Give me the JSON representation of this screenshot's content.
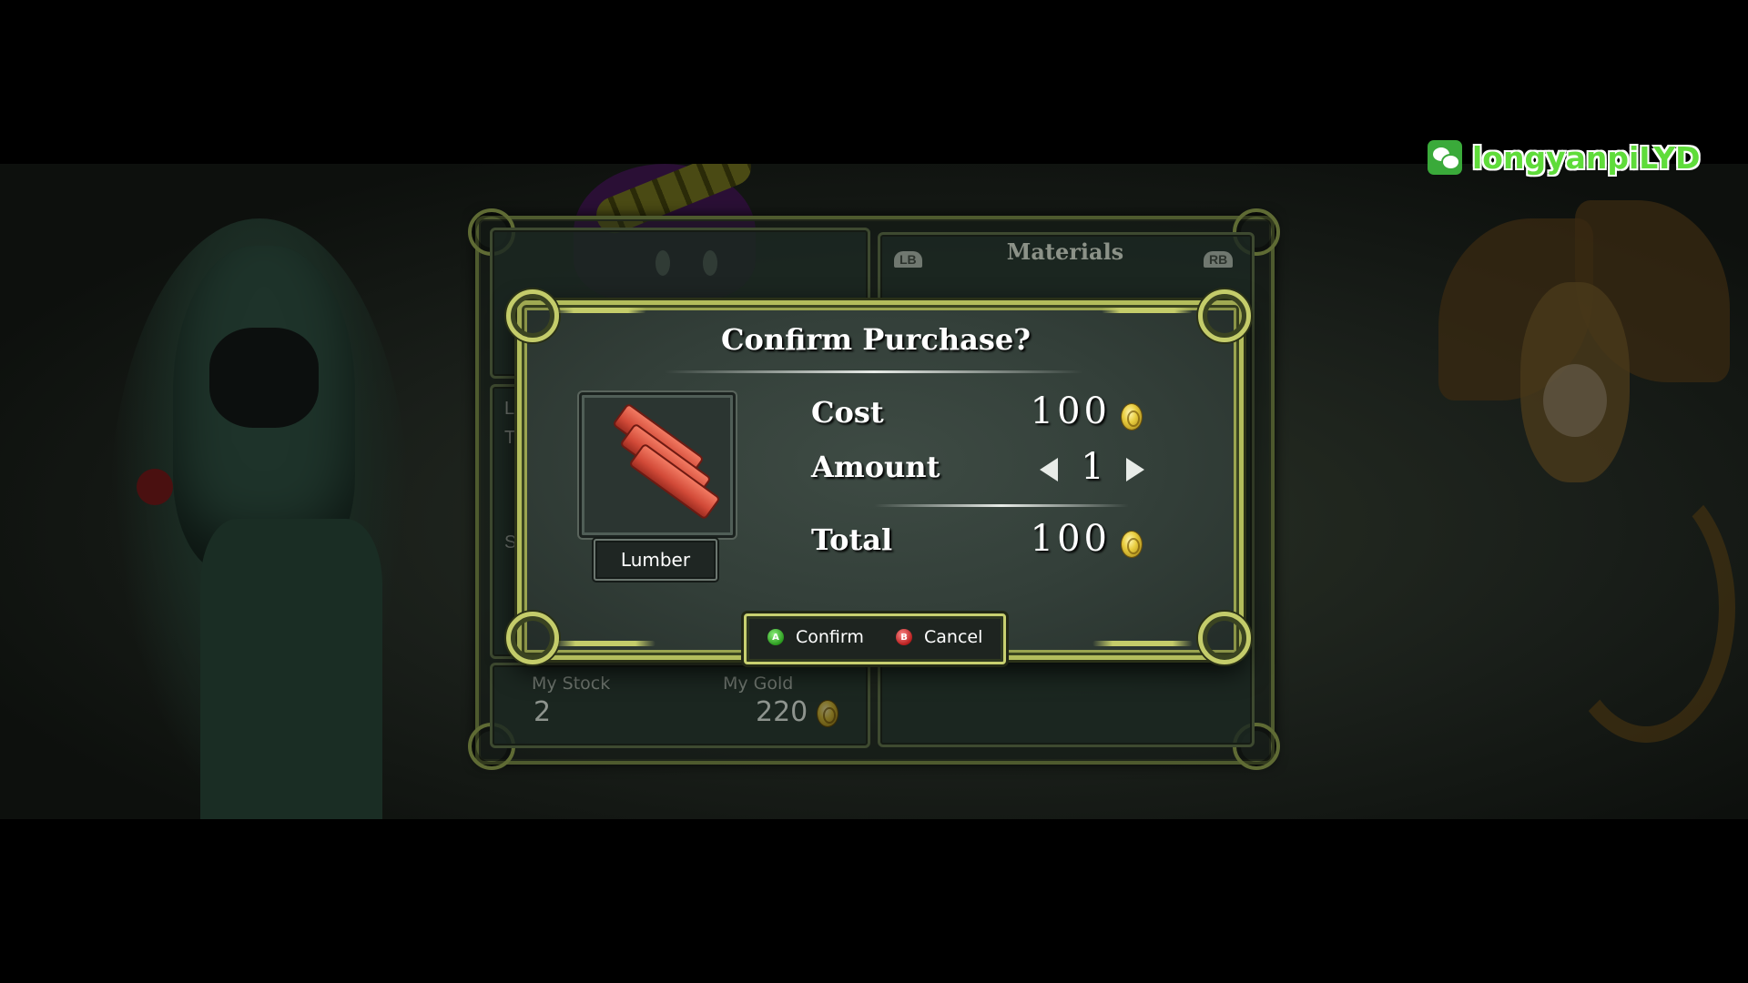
{
  "watermark": {
    "text": "longyanpiLYD",
    "icon": "wechat-icon"
  },
  "shop": {
    "category_title": "Materials",
    "left_shoulder": "LB",
    "right_shoulder": "RB",
    "my_stock_label": "My Stock",
    "my_stock_value": "2",
    "my_gold_label": "My Gold",
    "my_gold_value": "220"
  },
  "dialog": {
    "title": "Confirm Purchase?",
    "item_name": "Lumber",
    "item_icon": "lumber-icon",
    "cost_label": "Cost",
    "cost_value": "100",
    "amount_label": "Amount",
    "amount_value": "1",
    "total_label": "Total",
    "total_value": "100",
    "currency_icon": "gold-coin-icon"
  },
  "prompts": {
    "confirm_button": "A",
    "confirm_label": "Confirm",
    "cancel_button": "B",
    "cancel_label": "Cancel"
  },
  "colors": {
    "frame_accent": "#c4cc6a",
    "watermark_green": "#5fdc3a",
    "lumber_red": "#d24a38",
    "coin_gold": "#e8cc3e"
  }
}
